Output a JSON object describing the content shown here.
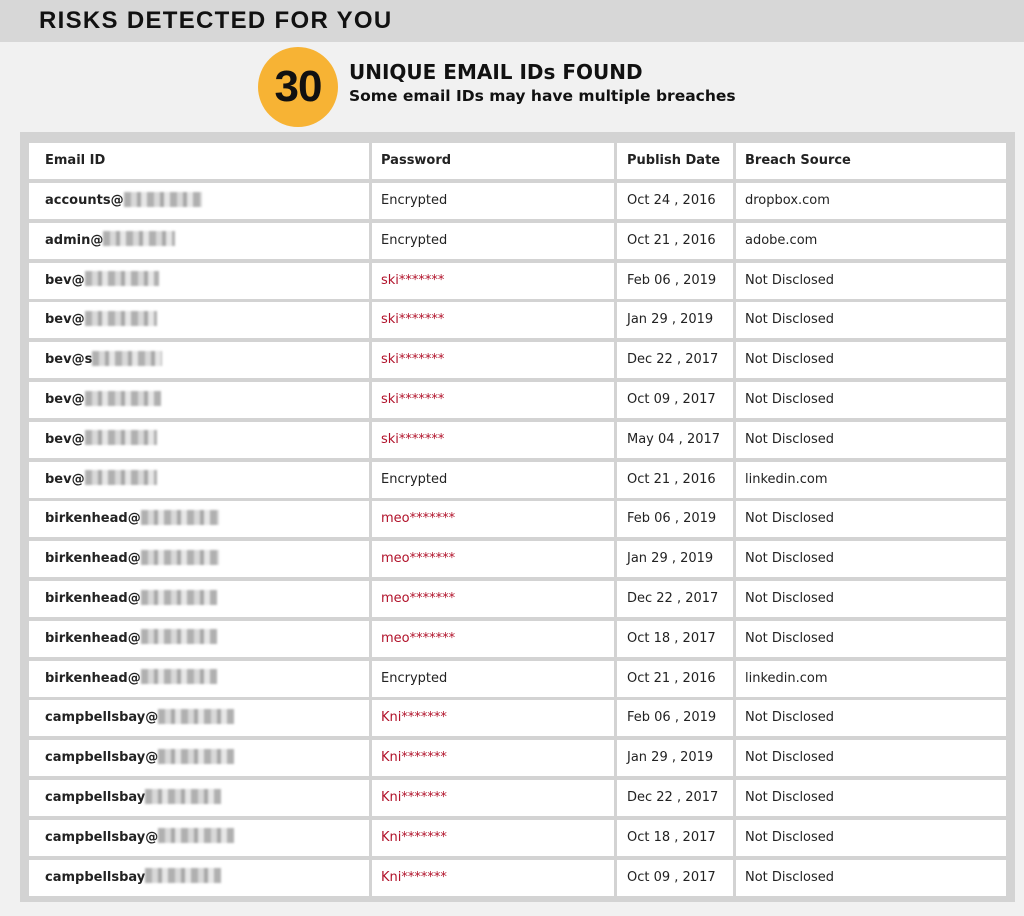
{
  "header": {
    "title": "RISKS DETECTED FOR YOU"
  },
  "summary": {
    "count": "30",
    "headline": "UNIQUE EMAIL IDs FOUND",
    "subheadline": "Some email IDs may have multiple breaches"
  },
  "colors": {
    "badge": "#f7b334",
    "header_bar": "#d7d7d7",
    "masked_password": "#b1122a"
  },
  "table": {
    "columns": [
      "Email ID",
      "Password",
      "Publish Date",
      "Breach Source"
    ],
    "rows": [
      {
        "email": "accounts@",
        "password": "Encrypted",
        "masked": false,
        "date": "Oct 24 , 2016",
        "source": "dropbox.com"
      },
      {
        "email": "admin@",
        "password": "Encrypted",
        "masked": false,
        "date": "Oct 21 , 2016",
        "source": "adobe.com"
      },
      {
        "email": "bev@",
        "password": "ski*******",
        "masked": true,
        "date": "Feb 06 , 2019",
        "source": "Not Disclosed"
      },
      {
        "email": "bev@",
        "password": "ski*******",
        "masked": true,
        "date": "Jan 29 , 2019",
        "source": "Not Disclosed"
      },
      {
        "email": "bev@s",
        "password": "ski*******",
        "masked": true,
        "date": "Dec 22 , 2017",
        "source": "Not Disclosed"
      },
      {
        "email": "bev@",
        "password": "ski*******",
        "masked": true,
        "date": "Oct 09 , 2017",
        "source": "Not Disclosed"
      },
      {
        "email": "bev@",
        "password": "ski*******",
        "masked": true,
        "date": "May 04 , 2017",
        "source": "Not Disclosed"
      },
      {
        "email": "bev@",
        "password": "Encrypted",
        "masked": false,
        "date": "Oct 21 , 2016",
        "source": "linkedin.com"
      },
      {
        "email": "birkenhead@",
        "password": "meo*******",
        "masked": true,
        "date": "Feb 06 , 2019",
        "source": "Not Disclosed"
      },
      {
        "email": "birkenhead@",
        "password": "meo*******",
        "masked": true,
        "date": "Jan 29 , 2019",
        "source": "Not Disclosed"
      },
      {
        "email": "birkenhead@",
        "password": "meo*******",
        "masked": true,
        "date": "Dec 22 , 2017",
        "source": "Not Disclosed"
      },
      {
        "email": "birkenhead@",
        "password": "meo*******",
        "masked": true,
        "date": "Oct 18 , 2017",
        "source": "Not Disclosed"
      },
      {
        "email": "birkenhead@",
        "password": "Encrypted",
        "masked": false,
        "date": "Oct 21 , 2016",
        "source": "linkedin.com"
      },
      {
        "email": "campbellsbay@",
        "password": "Kni*******",
        "masked": true,
        "date": "Feb 06 , 2019",
        "source": "Not Disclosed"
      },
      {
        "email": "campbellsbay@",
        "password": "Kni*******",
        "masked": true,
        "date": "Jan 29 , 2019",
        "source": "Not Disclosed"
      },
      {
        "email": "campbellsbay",
        "password": "Kni*******",
        "masked": true,
        "date": "Dec 22 , 2017",
        "source": "Not Disclosed"
      },
      {
        "email": "campbellsbay@",
        "password": "Kni*******",
        "masked": true,
        "date": "Oct 18 , 2017",
        "source": "Not Disclosed"
      },
      {
        "email": "campbellsbay",
        "password": "Kni*******",
        "masked": true,
        "date": "Oct 09 , 2017",
        "source": "Not Disclosed"
      }
    ]
  }
}
